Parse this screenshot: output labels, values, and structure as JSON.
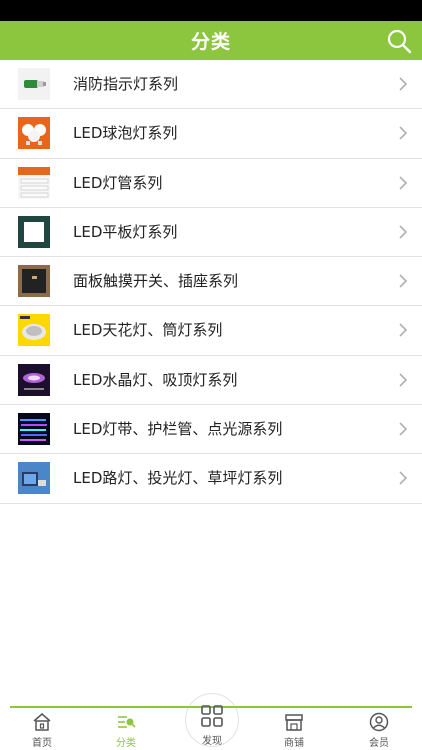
{
  "header": {
    "title": "分类"
  },
  "categories": [
    {
      "label": "消防指示灯系列",
      "thumb_icon": "exit-sign-icon"
    },
    {
      "label": "LED球泡灯系列",
      "thumb_icon": "bulb-icon"
    },
    {
      "label": "LED灯管系列",
      "thumb_icon": "tube-icon"
    },
    {
      "label": "LED平板灯系列",
      "thumb_icon": "panel-light-icon"
    },
    {
      "label": "面板触摸开关、插座系列",
      "thumb_icon": "switch-icon"
    },
    {
      "label": "LED天花灯、筒灯系列",
      "thumb_icon": "downlight-icon"
    },
    {
      "label": "LED水晶灯、吸顶灯系列",
      "thumb_icon": "crystal-light-icon"
    },
    {
      "label": "LED灯带、护栏管、点光源系列",
      "thumb_icon": "strip-light-icon"
    },
    {
      "label": "LED路灯、投光灯、草坪灯系列",
      "thumb_icon": "street-light-icon"
    }
  ],
  "tabbar": {
    "home": "首页",
    "category": "分类",
    "discover": "发现",
    "shop": "商铺",
    "member": "会员"
  },
  "colors": {
    "accent": "#8cc63f",
    "text": "#222222",
    "divider": "#e2e2e2"
  }
}
